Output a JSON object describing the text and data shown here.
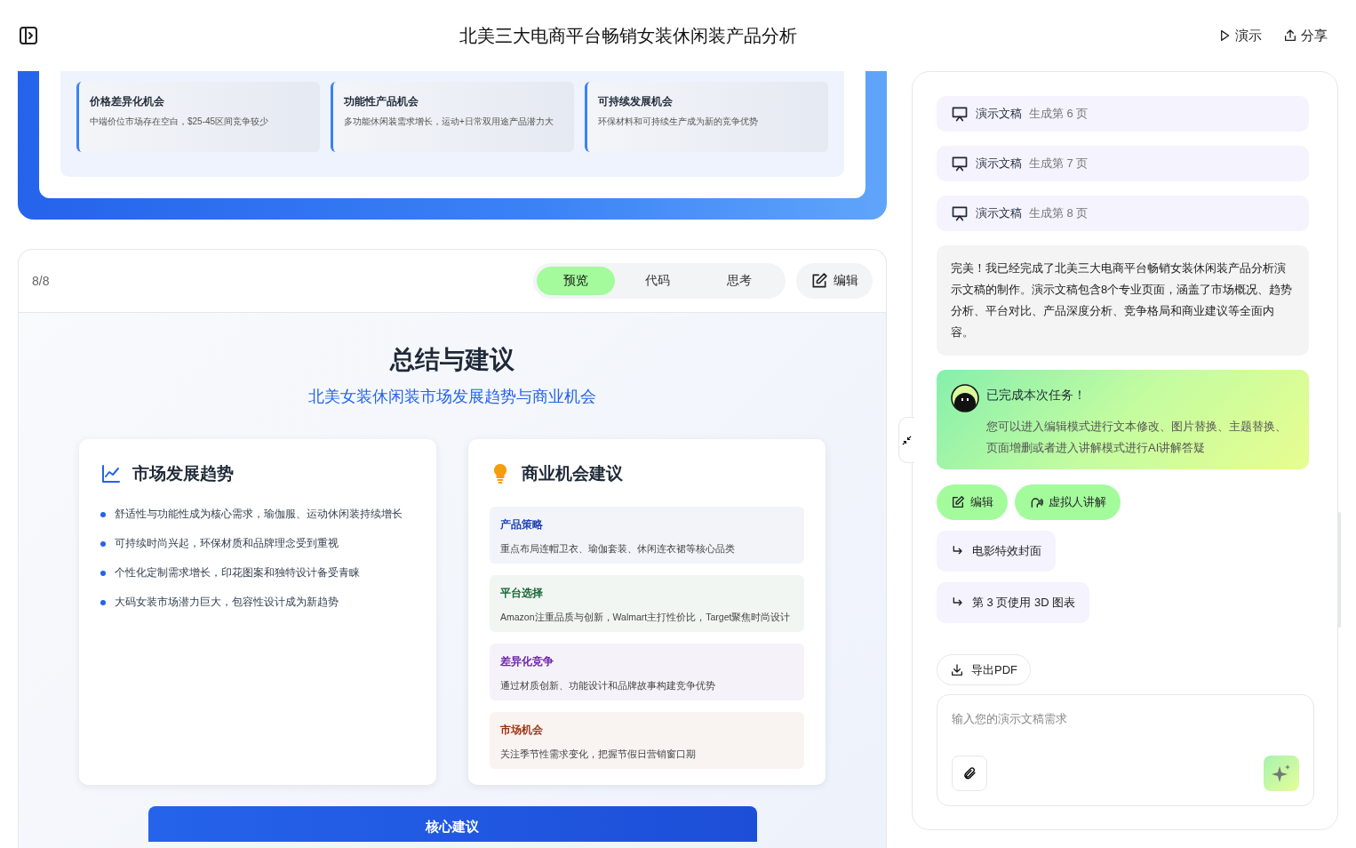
{
  "header": {
    "title": "北美三大电商平台畅销女装休闲装产品分析",
    "actions": [
      {
        "kind": "play",
        "label": "演示"
      },
      {
        "kind": "share",
        "label": "分享"
      }
    ]
  },
  "prev_slide": {
    "cards": [
      {
        "title": "价格差异化机会",
        "text": "中端价位市场存在空白，$25-45区间竞争较少"
      },
      {
        "title": "功能性产品机会",
        "text": "多功能休闲装需求增长，运动+日常双用途产品潜力大"
      },
      {
        "title": "可持续发展机会",
        "text": "环保材料和可持续生产成为新的竞争优势"
      }
    ]
  },
  "viewer": {
    "page": "8/8",
    "tabs": [
      {
        "label": "预览",
        "selected": true
      },
      {
        "label": "代码",
        "selected": false
      },
      {
        "label": "思考",
        "selected": false
      }
    ],
    "edit_button": "编辑",
    "slide": {
      "title": "总结与建议",
      "subtitle": "北美女装休闲装市场发展趋势与商业机会",
      "trends": {
        "heading": "市场发展趋势",
        "items": [
          "舒适性与功能性成为核心需求，瑜伽服、运动休闲装持续增长",
          "可持续时尚兴起，环保材质和品牌理念受到重视",
          "个性化定制需求增长，印花图案和独特设计备受青睐",
          "大码女装市场潜力巨大，包容性设计成为新趋势"
        ]
      },
      "advice": {
        "heading": "商业机会建议",
        "items": [
          {
            "title": "产品策略",
            "text": "重点布局连帽卫衣、瑜伽套装、休闲连衣裙等核心品类",
            "color": "#1e40af"
          },
          {
            "title": "平台选择",
            "text": "Amazon注重品质与创新，Walmart主打性价比，Target聚焦时尚设计",
            "color": "#166534"
          },
          {
            "title": "差异化竞争",
            "text": "通过材质创新、功能设计和品牌故事构建竞争优势",
            "color": "#6b21a8"
          },
          {
            "title": "市场机会",
            "text": "关注季节性需求变化，把握节假日营销窗口期",
            "color": "#9a3412"
          }
        ]
      },
      "banner": "核心建议"
    }
  },
  "chat": {
    "progress": [
      {
        "label": "演示文稿",
        "status": "生成第 6 页"
      },
      {
        "label": "演示文稿",
        "status": "生成第 7 页"
      },
      {
        "label": "演示文稿",
        "status": "生成第 8 页"
      }
    ],
    "message": "完美！我已经完成了北美三大电商平台畅销女装休闲装产品分析演示文稿的制作。演示文稿包含8个专业页面，涵盖了市场概况、趋势分析、平台对比、产品深度分析、竞争格局和商业建议等全面内容。",
    "done": {
      "title": "已完成本次任务！",
      "text": "您可以进入编辑模式进行文本修改、图片替换、主题替换、页面增删或者进入讲解模式进行AI讲解答疑"
    },
    "actions": [
      {
        "kind": "edit",
        "label": "编辑"
      },
      {
        "kind": "voice",
        "label": "虚拟人讲解"
      }
    ],
    "suggestions": [
      "电影特效封面",
      "第 3 页使用 3D 图表"
    ],
    "export_button": "导出PDF",
    "input": {
      "placeholder": "输入您的演示文稿需求"
    }
  }
}
